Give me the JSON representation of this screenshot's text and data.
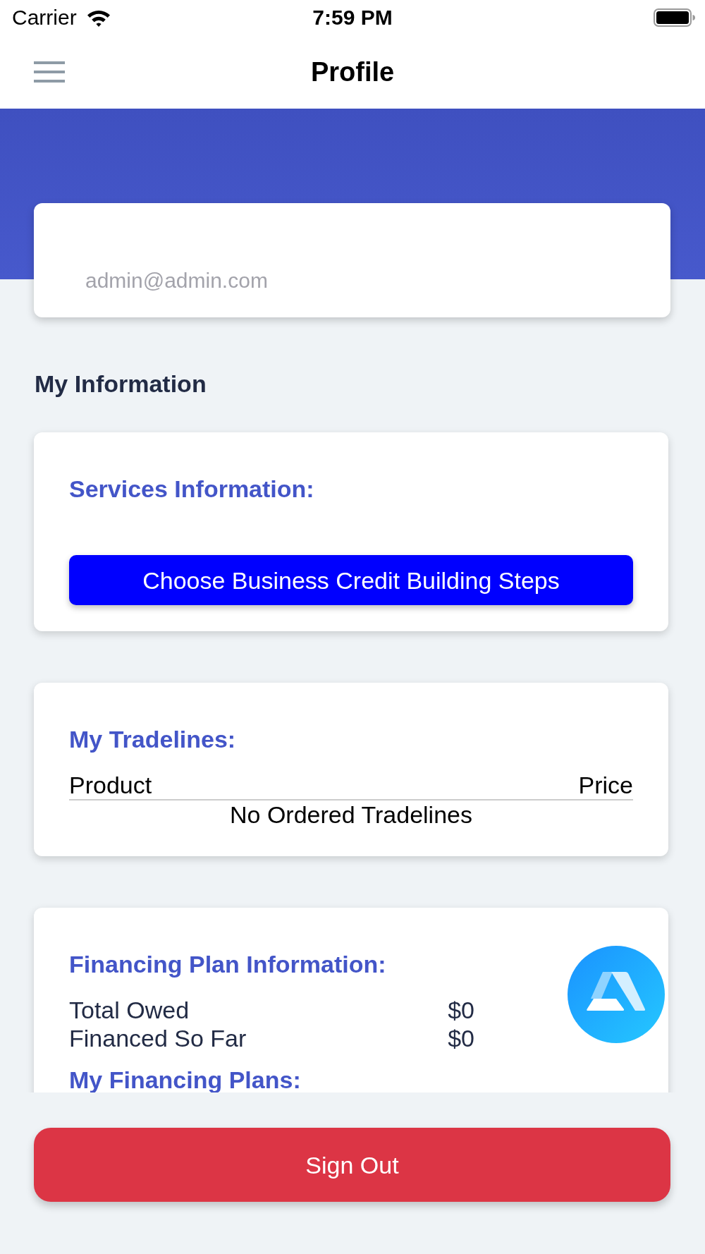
{
  "status_bar": {
    "carrier": "Carrier",
    "time": "7:59 PM"
  },
  "nav_bar": {
    "title": "Profile"
  },
  "profile_card": {
    "email": "admin@admin.com"
  },
  "section_title": "My Information",
  "cards": [
    {
      "kind": "services",
      "title": "Services Information:",
      "button": "Choose Business Credit Building Steps"
    },
    {
      "kind": "tradelines",
      "title": "My Tradelines:",
      "columns": [
        "Product",
        "Price"
      ],
      "empty_message": "No Ordered Tradelines"
    },
    {
      "kind": "financing",
      "title": "Financing Plan Information:",
      "rows": [
        {
          "label": "Total Owed",
          "value": "$0"
        },
        {
          "label": "Financed So Far",
          "value": "$0"
        }
      ],
      "subtitle": "My Financing Plans:"
    }
  ],
  "sign_out_button": "Sign Out"
}
